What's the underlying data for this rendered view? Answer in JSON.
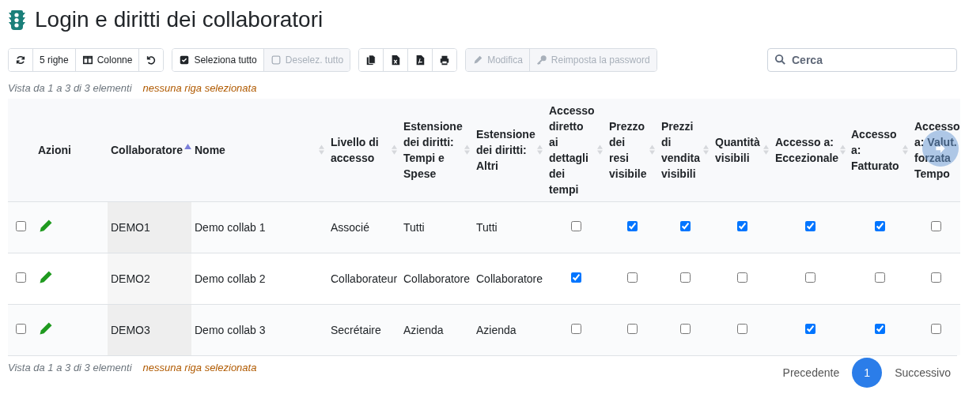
{
  "title": "Login e diritti dei collaboratori",
  "toolbar": [
    [
      {
        "disabled": false
      },
      {
        "label": "5 righe",
        "disabled": false
      },
      {
        "label": "Colonne",
        "disabled": false
      },
      {
        "disabled": false
      }
    ],
    [
      {
        "label": "Seleziona tutto",
        "disabled": false
      },
      {
        "label": "Deselez. tutto",
        "disabled": true
      }
    ],
    [
      {
        "disabled": false
      },
      {
        "disabled": false
      },
      {
        "disabled": false
      },
      {
        "disabled": false
      }
    ],
    [
      {
        "label": "Modifica",
        "disabled": true
      },
      {
        "label": "Reimposta la password",
        "disabled": true
      }
    ]
  ],
  "search": {
    "placeholder": "Cerca"
  },
  "info": {
    "range": "Vista da 1 a 3 di 3 elementi",
    "selection": "nessuna riga selezionata"
  },
  "footer_info": {
    "range": "Vista da 1 a 3 di 3 elementi",
    "selection": "nessuna riga selezionata"
  },
  "columns": [
    {
      "label": "Azioni"
    },
    {
      "label": "Collaboratore",
      "sorted": true
    },
    {
      "label": "Nome",
      "sorted": false
    },
    {
      "label": "Livello di accesso",
      "sorted": false
    },
    {
      "label": "Estensione dei diritti: Tempi e Spese",
      "sorted": false
    },
    {
      "label": "Estensione dei diritti: Altri",
      "sorted": false
    },
    {
      "label": "Accesso diretto ai dettagli dei tempi",
      "sorted": false
    },
    {
      "label": "Prezzo dei resi visibile",
      "sorted": false
    },
    {
      "label": "Prezzi di vendita visibili",
      "sorted": false
    },
    {
      "label": "Quantità visibili",
      "sorted": false
    },
    {
      "label": "Accesso a: Eccezionale",
      "sorted": false
    },
    {
      "label": "Accesso a: Fatturato",
      "sorted": false
    },
    {
      "label": "Accesso a: Valut. forzata Tempo"
    }
  ],
  "rows": [
    {
      "selected": false,
      "cells": [
        "DEMO1",
        "Demo collab 1",
        "Associé",
        "Tutti",
        "Tutti"
      ],
      "checks": [
        false,
        true,
        true,
        true,
        true,
        true,
        false
      ]
    },
    {
      "selected": false,
      "cells": [
        "DEMO2",
        "Demo collab 2",
        "Collaborateur",
        "Collaboratore",
        "Collaboratore"
      ],
      "checks": [
        true,
        false,
        false,
        false,
        false,
        false,
        false
      ]
    },
    {
      "selected": false,
      "cells": [
        "DEMO3",
        "Demo collab 3",
        "Secrétaire",
        "Azienda",
        "Azienda"
      ],
      "checks": [
        false,
        false,
        false,
        false,
        true,
        true,
        false
      ]
    }
  ],
  "pagination": {
    "previous": "Precedente",
    "pages": [
      {
        "label": "1",
        "selected": true
      }
    ],
    "next": "Successivo"
  }
}
